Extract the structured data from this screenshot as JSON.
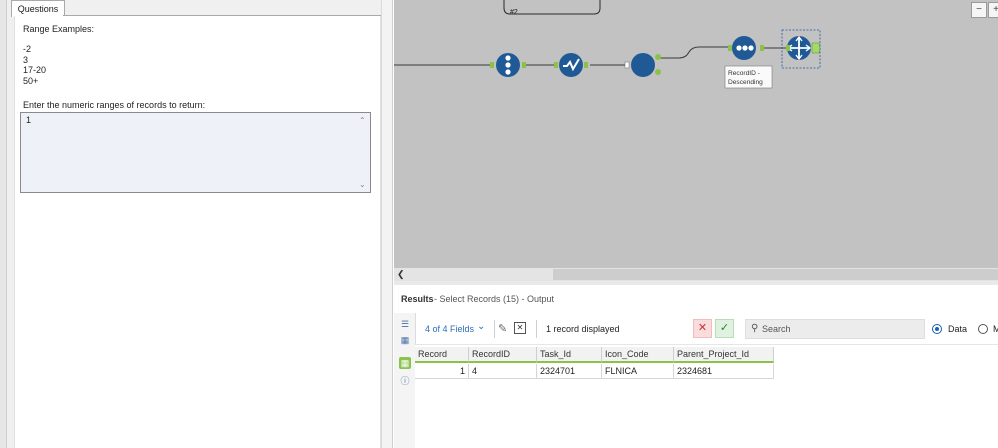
{
  "config": {
    "tab_label": "Questions",
    "range_examples_title": "Range Examples:",
    "range_examples": [
      "-2",
      "3",
      "17-20",
      "50+"
    ],
    "input_prompt": "Enter the numeric ranges of records to return:",
    "input_value": "1"
  },
  "canvas": {
    "background_color": "#c2c2c2",
    "tool_color": "#1f5a96",
    "connection_label": "#2",
    "record_id_annotation": "RecordID -\nDescending",
    "zoom_out_icon": "minus-icon",
    "zoom_in_icon": "plus-icon"
  },
  "results": {
    "title": "Results",
    "subtitle": "- Select Records (15) - Output",
    "fields_label": "4 of 4 Fields",
    "records_status": "1 record displayed",
    "search_placeholder": "Search",
    "view_data_label": "Data",
    "view_meta_label": "M",
    "accent_color": "#8bc34a",
    "columns": [
      "Record",
      "RecordID",
      "Task_Id",
      "Icon_Code",
      "Parent_Project_Id"
    ],
    "rows": [
      [
        "1",
        "4",
        "2324701",
        "FLNICA",
        "2324681"
      ]
    ]
  }
}
